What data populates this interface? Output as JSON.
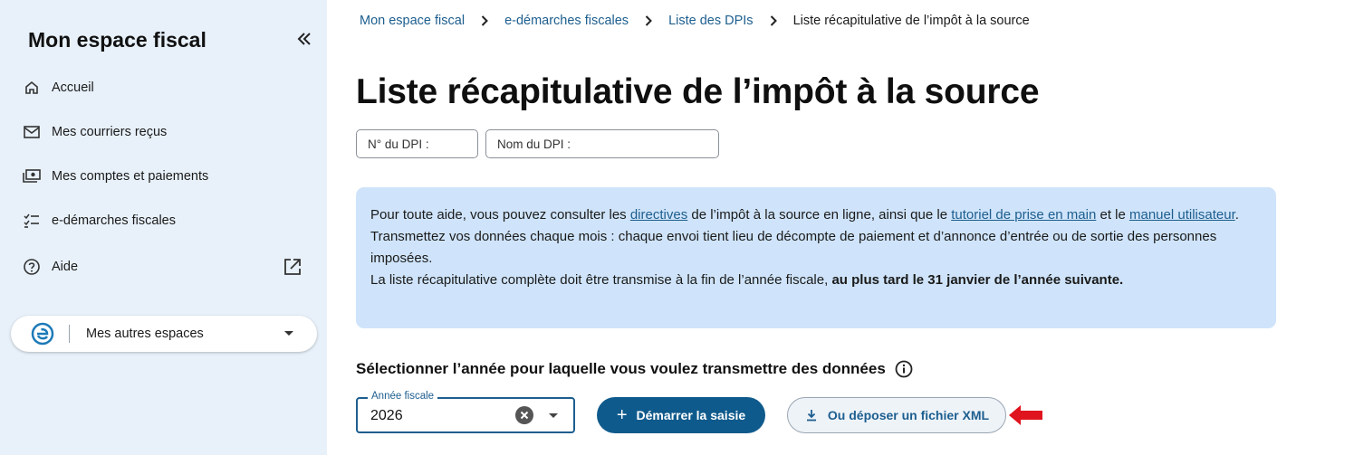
{
  "sidebar": {
    "title": "Mon espace fiscal",
    "items": [
      {
        "label": "Accueil",
        "icon": "home-icon"
      },
      {
        "label": "Mes courriers reçus",
        "icon": "mail-icon"
      },
      {
        "label": "Mes comptes et paiements",
        "icon": "payments-icon"
      },
      {
        "label": "e-démarches fiscales",
        "icon": "checklist-icon"
      },
      {
        "label": "Aide",
        "icon": "help-icon"
      }
    ],
    "other_spaces": "Mes autres espaces"
  },
  "breadcrumb": {
    "items": [
      "Mon espace fiscal",
      "e-démarches fiscales",
      "Liste des DPIs"
    ],
    "current": "Liste récapitulative de l’impôt à la source"
  },
  "page_title": "Liste récapitulative de l’impôt à la source",
  "filters": {
    "dpi_number_placeholder": "N° du DPI :",
    "dpi_name_placeholder": "Nom du DPI :"
  },
  "info": {
    "p1_a": "Pour toute aide, vous pouvez consulter les ",
    "link_directives": "directives",
    "p1_b": " de l’impôt à la source en ligne, ainsi que le ",
    "link_tutoriel": "tutoriel de prise en main",
    "p1_c": " et le ",
    "link_manuel": "manuel utilisateur",
    "p1_d": ".",
    "p2": "Transmettez vos données chaque mois : chaque envoi tient lieu de décompte de paiement et d’annonce d’entrée ou de sortie des personnes imposées.",
    "p3_a": "La liste récapitulative complète doit être transmise à la fin de l’année fiscale, ",
    "p3_bold": "au plus tard le 31 janvier de l’année suivante."
  },
  "year_selection": {
    "title": "Sélectionner l’année pour laquelle vous voulez transmettre des données",
    "field_label": "Année fiscale",
    "value": "2026",
    "start_button": "Démarrer la saisie",
    "xml_button": "Ou déposer un fichier XML"
  },
  "colors": {
    "sidebar_bg": "#e8f1fa",
    "primary": "#0f5a8c",
    "link": "#1d5e8f",
    "info_bg": "#cfe4fa",
    "annotation_arrow": "#e0141e"
  }
}
